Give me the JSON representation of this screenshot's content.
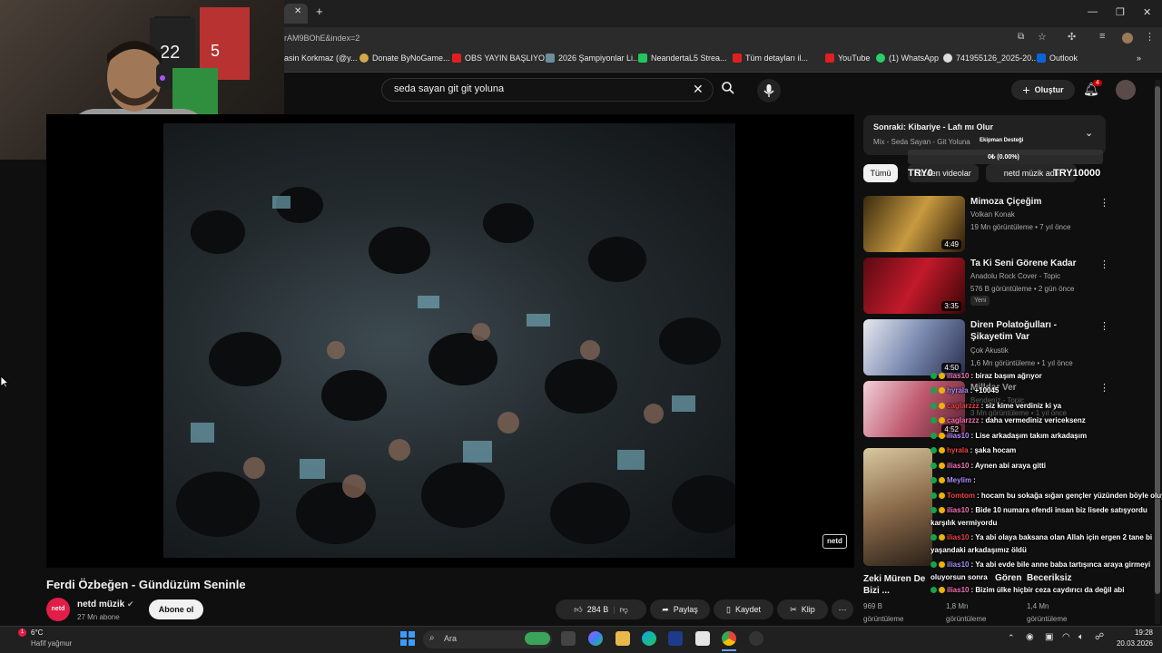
{
  "browser": {
    "url": "rAM9BOhE&index=2",
    "bookmarks": [
      "asin Korkmaz (@y...",
      "Donate ByNoGame...",
      "OBS YAYIN BAŞLIYO...",
      "2026 Şampiyonlar Li...",
      "NeandertaL5 Strea...",
      "Tüm detayları il...",
      "YouTube",
      "(1) WhatsApp",
      "741955126_2025-20...",
      "Outlook"
    ]
  },
  "youtube": {
    "search_query": "seda sayan git git yoluna",
    "create_label": "Oluştur",
    "notif_count": "4",
    "video": {
      "title": "Ferdi Özbeğen - Gündüzüm Seninle",
      "channel": "netd müzik",
      "subscribers": "27 Mn abone",
      "subscribe_label": "Abone ol",
      "likes": "284 B",
      "share_label": "Paylaş",
      "save_label": "Kaydet",
      "clip_label": "Klip",
      "watermark": "netd"
    },
    "next": {
      "title": "Sonraki: Kibariye - Lafı mı Olur",
      "subtitle": "Mix - Seda Sayan - Git Yoluna",
      "overlay_goal": "Ekipman Desteği",
      "overlay_pct": "0₺ (0.00%)",
      "overlay_left": "TRY0",
      "overlay_right": "TRY10000"
    },
    "filters": [
      "Tümü",
      "Sizden videolar",
      "netd müzik adlı"
    ],
    "recs": [
      {
        "title": "Mimoza Çiçeğim",
        "channel": "Volkan Konak",
        "meta": "19 Mn görüntüleme • 7 yıl önce",
        "duration": "4:49",
        "badge": ""
      },
      {
        "title": "Ta Ki Seni Görene Kadar",
        "channel": "Anadolu Rock Cover - Topic",
        "meta": "576 B görüntüleme • 2 gün önce",
        "duration": "3:35",
        "badge": "Yeni"
      },
      {
        "title": "Diren Polatoğulları - Şikayetim Var",
        "channel": "Çok Akustik",
        "meta": "1,6 Mn görüntüleme • 1 yıl önce",
        "duration": "4:50",
        "badge": ""
      },
      {
        "title": "Milldar Ver",
        "channel": "Bendeniz - Topic",
        "meta": "3 Mn görüntüleme • 1 yıl önce",
        "duration": "4:52",
        "badge": ""
      }
    ],
    "bottom_recs": [
      {
        "title": "Zeki Müren De Bizi ...",
        "views": "969 B",
        "sub": "görüntüleme"
      },
      {
        "title": "Gören",
        "views": "1,8 Mn",
        "sub": "görüntüleme"
      },
      {
        "title": "Beceriksiz",
        "views": "1,4 Mn",
        "sub": "görüntüleme"
      }
    ]
  },
  "chat": [
    {
      "user": "ilias10",
      "msg": ": biraz başım ağrıyor"
    },
    {
      "user": "hyrala",
      "msg": ": +10045"
    },
    {
      "user": "caglarzzz",
      "msg": ": siz kime verdiniz ki ya"
    },
    {
      "user": "caglarzzz",
      "msg": ": daha vermediniz vericeksenz"
    },
    {
      "user": "ilias10",
      "msg": ": Lise arkadaşım takım arkadaşım"
    },
    {
      "user": "hyrala",
      "msg": ": şaka hocam"
    },
    {
      "user": "ilias10",
      "msg": ": Aynen abi araya gitti"
    },
    {
      "user": "Meylim",
      "msg": ":"
    },
    {
      "user": "Tomtom",
      "msg": ": hocam bu sokağa sığan gençler yüzünden böyle oluyor"
    },
    {
      "user": "ilias10",
      "msg": ": Bide 10 numara efendi insan biz lisede satışyordu"
    },
    {
      "user": "",
      "msg": "karşılık vermiyordu"
    },
    {
      "user": "ilias10",
      "msg": ": Ya abi olaya baksana olan Allah için ergen 2 tane bi"
    },
    {
      "user": "",
      "msg": "yaşandaki arkadaşımız öldü"
    },
    {
      "user": "ilias10",
      "msg": ": Ya abi evde bile anne baba tartışınca araya girmeyi"
    },
    {
      "user": "",
      "msg": "oluyorsun sonra"
    },
    {
      "user": "ilias10",
      "msg": ": Bizim ülke hiçbir ceza caydırıcı da değil abi"
    }
  ],
  "taskbar": {
    "weather_temp": "6°C",
    "weather_desc": "Hafif yağmur",
    "search_label": "Ara",
    "time": "19:28",
    "date": "20.03.2026"
  }
}
